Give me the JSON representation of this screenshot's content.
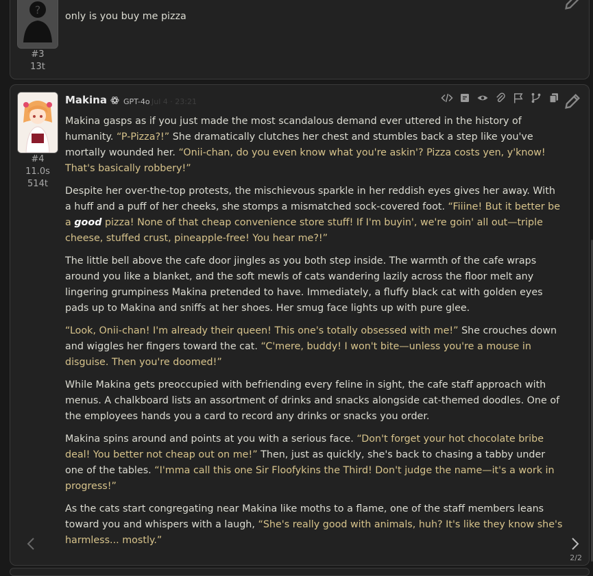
{
  "message3": {
    "id": "#3",
    "tokens": "13t",
    "text": "only is you buy me pizza"
  },
  "message4": {
    "name": "Makina",
    "model": "GPT-4o",
    "timestamp": "Jul 4 · 23:21",
    "id": "#4",
    "time": "11.0s",
    "tokens": "514t",
    "swipe_counter": "2/2",
    "p1_a": "Makina gasps as if you just made the most scandalous demand ever uttered in the history of humanity. ",
    "p1_q1": "“P-Pizza?!”",
    "p1_b": " She dramatically clutches her chest and stumbles back a step like you've mortally wounded her. ",
    "p1_q2": "“Onii-chan, do you even know what you're askin'? Pizza costs yen, y'know! That's basically robbery!”",
    "p2_a": "Despite her over-the-top protests, the mischievous sparkle in her reddish eyes gives her away. With a huff and a puff of her cheeks, she stomps a mismatched sock-covered foot. ",
    "p2_q1": "“Fiiine! But it better be a ",
    "p2_em": "good",
    "p2_q2": " pizza! None of that cheap convenience store stuff! If I'm buyin', we're goin' all out—triple cheese, stuffed crust, pineapple-free! You hear me?!”",
    "p3": "The little bell above the cafe door jingles as you both step inside. The warmth of the cafe wraps around you like a blanket, and the soft mewls of cats wandering lazily across the floor melt any lingering grumpiness Makina pretended to have. Immediately, a fluffy black cat with golden eyes pads up to Makina and sniffs at her shoes. Her smug face lights up with pure glee.",
    "p4_q1": "“Look, Onii-chan! I'm already their queen! This one's totally obsessed with me!”",
    "p4_b": " She crouches down and wiggles her fingers toward the cat. ",
    "p4_q2": "“C'mere, buddy! I won't bite—unless you're a mouse in disguise. Then you're doomed!”",
    "p5": "While Makina gets preoccupied with befriending every feline in sight, the cafe staff approach with menus. A chalkboard lists an assortment of drinks and snacks alongside cat-themed doodles. One of the employees hands you a card to record any drinks or snacks you order.",
    "p6_a": "Makina spins around and points at you with a serious face. ",
    "p6_q1": "“Don't forget your hot chocolate bribe deal! You better not cheap out on me!”",
    "p6_b": " Then, just as quickly, she's back to chasing a tabby under one of the tables. ",
    "p6_q2": "“I'mma call this one Sir Floofykins the Third! Don't judge the name—it's a work in progress!”",
    "p7_a": "As the cats start congregating near Makina like moths to a flame, one of the staff members leans toward you and whispers with a laugh, ",
    "p7_q1": "“She's really good with animals, huh? It's like they know she's harmless... mostly.”"
  }
}
